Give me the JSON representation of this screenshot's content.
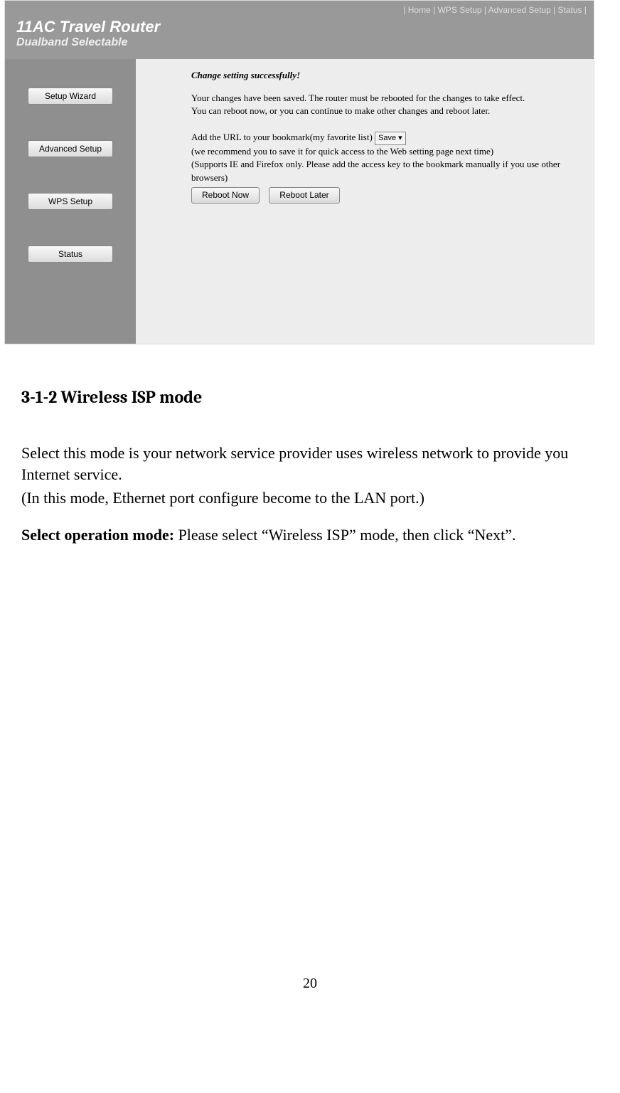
{
  "router": {
    "topnav": "| Home | WPS Setup | Advanced Setup | Status |",
    "title": "11AC Travel Router",
    "subtitle": "Dualband Selectable",
    "sidebar": {
      "setup_wizard": "Setup Wizard",
      "advanced_setup": "Advanced Setup",
      "wps_setup": "WPS Setup",
      "status": "Status"
    },
    "main": {
      "heading": "Change setting successfully!",
      "p1": "Your changes have been saved. The router must be rebooted for the changes to take effect.",
      "p2": "You can reboot now, or you can continue to make other changes and reboot later.",
      "p3a": "Add the URL to your bookmark(my favorite list)",
      "save_select": "Save  ▾",
      "p4": "(we recommend you to save it for quick access to the Web setting page next time)",
      "p5": "(Supports IE and Firefox only. Please add the access key to the bookmark manually if you use other browsers)",
      "reboot_now": "Reboot Now",
      "reboot_later": "Reboot Later"
    }
  },
  "doc": {
    "heading": "3-1-2 Wireless ISP mode",
    "para1": "Select this mode is your network service provider uses wireless network to provide you Internet service.",
    "para2": "(In this mode, Ethernet port configure become to the LAN port.)",
    "para3_bold": "Select operation mode:",
    "para3_rest": " Please select “Wireless ISP” mode, then click “Next”.",
    "page_number": "20"
  }
}
